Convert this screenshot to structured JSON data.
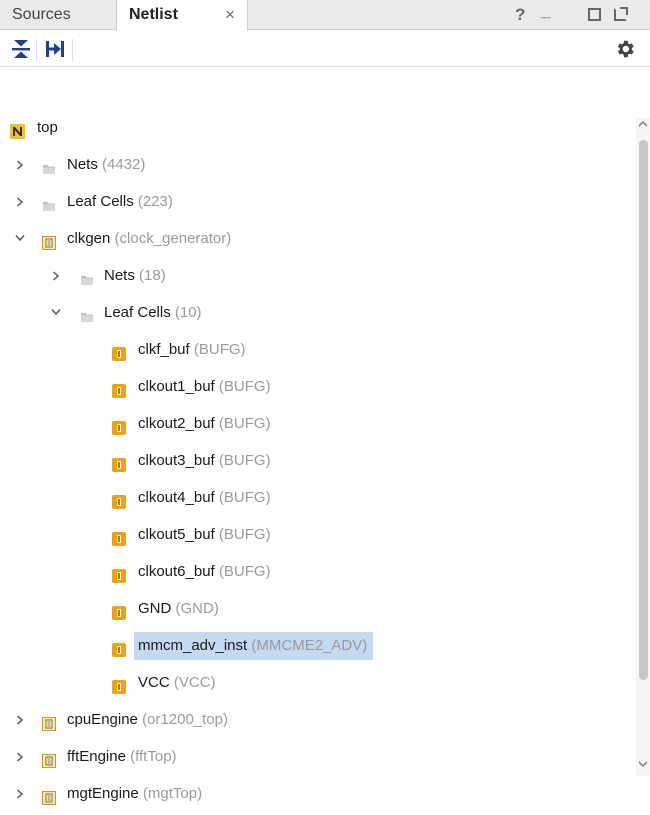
{
  "tabs": [
    {
      "label": "Sources",
      "active": false
    },
    {
      "label": "Netlist",
      "active": true,
      "close": "×"
    }
  ],
  "window_controls": {
    "help": "?",
    "minimize": "_"
  },
  "toolbar": {
    "collapse_all_icon": "collapse-all-icon",
    "expand_all_icon": "expand-all-icon",
    "settings_icon": "gear-icon"
  },
  "colors": {
    "selection": "#c5d9f1",
    "cell_icon": "#e8a416",
    "module_icon": "#c89a2a",
    "folder_icon": "#c0c0c0",
    "detail_text": "#9a9a9a"
  },
  "tree": {
    "rows": [
      {
        "name": "top",
        "detail": "",
        "icon": "netlist-top-icon",
        "chevron": "none",
        "level": 0,
        "selected": false
      },
      {
        "name": "Nets",
        "detail": "(4432)",
        "icon": "folder-icon",
        "chevron": "right",
        "level": 0,
        "selected": false
      },
      {
        "name": "Leaf Cells",
        "detail": "(223)",
        "icon": "folder-icon",
        "chevron": "right",
        "level": 0,
        "selected": false
      },
      {
        "name": "clkgen",
        "detail": "(clock_generator)",
        "icon": "module-icon",
        "chevron": "down",
        "level": 0,
        "selected": false
      },
      {
        "name": "Nets",
        "detail": "(18)",
        "icon": "folder-icon",
        "chevron": "right",
        "level": 1,
        "selected": false
      },
      {
        "name": "Leaf Cells",
        "detail": "(10)",
        "icon": "folder-icon",
        "chevron": "down",
        "level": 1,
        "selected": false
      },
      {
        "name": "clkf_buf",
        "detail": "(BUFG)",
        "icon": "cell-icon",
        "chevron": "none",
        "level": 2,
        "selected": false
      },
      {
        "name": "clkout1_buf",
        "detail": "(BUFG)",
        "icon": "cell-icon",
        "chevron": "none",
        "level": 2,
        "selected": false
      },
      {
        "name": "clkout2_buf",
        "detail": "(BUFG)",
        "icon": "cell-icon",
        "chevron": "none",
        "level": 2,
        "selected": false
      },
      {
        "name": "clkout3_buf",
        "detail": "(BUFG)",
        "icon": "cell-icon",
        "chevron": "none",
        "level": 2,
        "selected": false
      },
      {
        "name": "clkout4_buf",
        "detail": "(BUFG)",
        "icon": "cell-icon",
        "chevron": "none",
        "level": 2,
        "selected": false
      },
      {
        "name": "clkout5_buf",
        "detail": "(BUFG)",
        "icon": "cell-icon",
        "chevron": "none",
        "level": 2,
        "selected": false
      },
      {
        "name": "clkout6_buf",
        "detail": "(BUFG)",
        "icon": "cell-icon",
        "chevron": "none",
        "level": 2,
        "selected": false
      },
      {
        "name": "GND",
        "detail": "(GND)",
        "icon": "cell-icon",
        "chevron": "none",
        "level": 2,
        "selected": false
      },
      {
        "name": "mmcm_adv_inst",
        "detail": "(MMCME2_ADV)",
        "icon": "cell-icon",
        "chevron": "none",
        "level": 2,
        "selected": true
      },
      {
        "name": "VCC",
        "detail": "(VCC)",
        "icon": "cell-icon",
        "chevron": "none",
        "level": 2,
        "selected": false
      },
      {
        "name": "cpuEngine",
        "detail": "(or1200_top)",
        "icon": "module-icon",
        "chevron": "right",
        "level": 0,
        "selected": false
      },
      {
        "name": "fftEngine",
        "detail": "(fftTop)",
        "icon": "module-icon",
        "chevron": "right",
        "level": 0,
        "selected": false
      },
      {
        "name": "mgtEngine",
        "detail": "(mgtTop)",
        "icon": "module-icon",
        "chevron": "right",
        "level": 0,
        "selected": false
      }
    ]
  }
}
